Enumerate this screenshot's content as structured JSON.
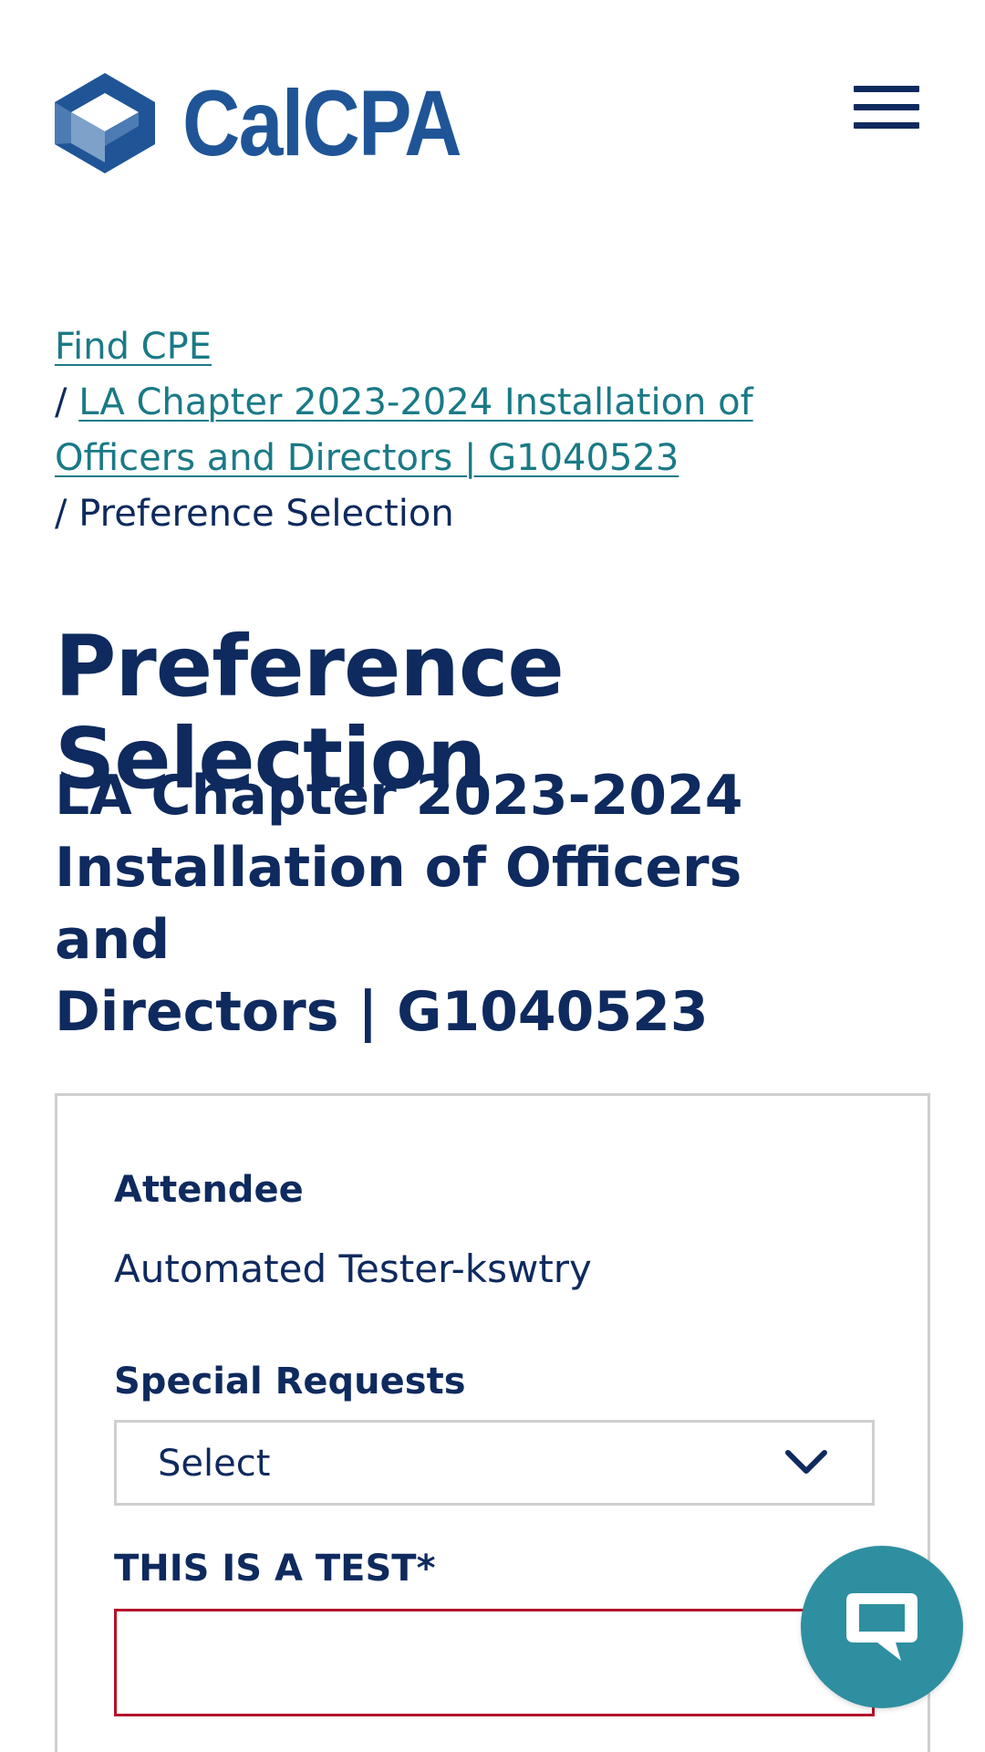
{
  "header": {
    "logo_text": "CalCPA",
    "menu_icon": "hamburger-menu-icon"
  },
  "breadcrumb": {
    "items": [
      {
        "label": "Find CPE",
        "link": true
      },
      {
        "label_line1": "LA Chapter 2023-2024 Installation of",
        "label_line2": "Officers and Directors | G1040523",
        "link": true
      },
      {
        "label": "Preference Selection",
        "link": false
      }
    ],
    "separator": "/"
  },
  "main": {
    "page_title": "Preference Selection",
    "event_title_lines": [
      "LA Chapter 2023-2024",
      "Installation of Officers and",
      "Directors | G1040523"
    ]
  },
  "form": {
    "attendee_label": "Attendee",
    "attendee_value": "Automated Tester-kswtry",
    "special_requests_label": "Special Requests",
    "special_requests_selected": "Select",
    "test_field_label": "THIS IS A TEST*",
    "test_field_value": ""
  },
  "chat": {
    "icon": "chat-bubble-icon"
  },
  "colors": {
    "brand_blue": "#1f5596",
    "navy_text": "#0e2a5e",
    "link_teal": "#1a7a86",
    "error_red": "#b5122b",
    "chat_teal": "#2e8fa0"
  }
}
